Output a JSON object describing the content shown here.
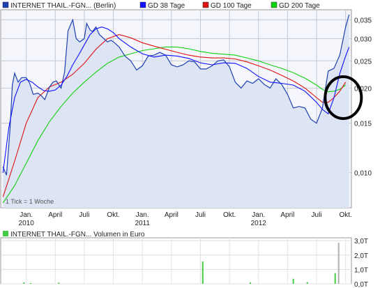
{
  "chart_data": {
    "type": "line",
    "legend": [
      {
        "label": "INTERNET THAIL.-FGN... (Berlin)",
        "color": "#1f3fb0",
        "key": "price"
      },
      {
        "label": "GD 38 Tage",
        "color": "#1010ff",
        "key": "ma38"
      },
      {
        "label": "GD 100 Tage",
        "color": "#e01010",
        "key": "ma100"
      },
      {
        "label": "GD 200 Tage",
        "color": "#10d010",
        "key": "ma200"
      }
    ],
    "x_ticks": [
      {
        "label": "Jan.",
        "year": "2010",
        "t": 0.0
      },
      {
        "label": "April",
        "t": 0.25
      },
      {
        "label": "Juli",
        "t": 0.5
      },
      {
        "label": "Okt.",
        "t": 0.75
      },
      {
        "label": "Jan.",
        "year": "2011",
        "t": 1.0
      },
      {
        "label": "April",
        "t": 1.25
      },
      {
        "label": "Juli",
        "t": 1.5
      },
      {
        "label": "Okt.",
        "t": 1.75
      },
      {
        "label": "Jan.",
        "year": "2012",
        "t": 2.0
      },
      {
        "label": "April",
        "t": 2.25
      },
      {
        "label": "Juli",
        "t": 2.5
      },
      {
        "label": "Okt.",
        "t": 2.75
      }
    ],
    "y_ticks": [
      "0,035",
      "0,030",
      "0,025",
      "0,020",
      "0,015",
      "0,010"
    ],
    "y_tick_values": [
      0.035,
      0.03,
      0.025,
      0.02,
      0.015,
      0.01
    ],
    "y_scale": "log",
    "ylim": [
      0.0075,
      0.038
    ],
    "xlim": [
      -0.22,
      2.8
    ],
    "note": "1 Tick = 1 Woche",
    "series": [
      {
        "key": "price",
        "x": [
          -0.2,
          -0.17,
          -0.14,
          -0.12,
          -0.1,
          -0.07,
          -0.04,
          0.0,
          0.03,
          0.06,
          0.1,
          0.13,
          0.16,
          0.2,
          0.23,
          0.26,
          0.3,
          0.33,
          0.36,
          0.4,
          0.43,
          0.46,
          0.5,
          0.52,
          0.55,
          0.57,
          0.6,
          0.63,
          0.66,
          0.7,
          0.73,
          0.76,
          0.8,
          0.85,
          0.9,
          0.95,
          1.0,
          1.05,
          1.1,
          1.15,
          1.2,
          1.25,
          1.3,
          1.35,
          1.4,
          1.45,
          1.5,
          1.55,
          1.6,
          1.65,
          1.7,
          1.75,
          1.8,
          1.85,
          1.9,
          1.95,
          2.0,
          2.05,
          2.1,
          2.15,
          2.2,
          2.25,
          2.3,
          2.35,
          2.4,
          2.45,
          2.5,
          2.55,
          2.6,
          2.65,
          2.7,
          2.73,
          2.75,
          2.78
        ],
        "values": [
          0.0105,
          0.0098,
          0.0142,
          0.0205,
          0.0226,
          0.021,
          0.0218,
          0.0218,
          0.0208,
          0.019,
          0.0192,
          0.0188,
          0.0182,
          0.0202,
          0.021,
          0.0212,
          0.02,
          0.0228,
          0.032,
          0.035,
          0.03,
          0.0292,
          0.03,
          0.034,
          0.0322,
          0.0318,
          0.033,
          0.031,
          0.0302,
          0.0292,
          0.0296,
          0.029,
          0.028,
          0.026,
          0.025,
          0.0232,
          0.024,
          0.026,
          0.0262,
          0.0268,
          0.0262,
          0.0242,
          0.0238,
          0.0242,
          0.025,
          0.0248,
          0.0234,
          0.0234,
          0.024,
          0.025,
          0.0252,
          0.0238,
          0.021,
          0.02,
          0.0212,
          0.0208,
          0.0216,
          0.0206,
          0.02,
          0.0216,
          0.0206,
          0.019,
          0.017,
          0.0172,
          0.017,
          0.0155,
          0.015,
          0.017,
          0.023,
          0.0235,
          0.0262,
          0.03,
          0.033,
          0.0365
        ]
      },
      {
        "key": "ma38",
        "x": [
          -0.2,
          -0.15,
          -0.1,
          -0.05,
          0.0,
          0.05,
          0.1,
          0.15,
          0.2,
          0.25,
          0.3,
          0.35,
          0.4,
          0.45,
          0.5,
          0.55,
          0.6,
          0.65,
          0.7,
          0.75,
          0.8,
          0.9,
          1.0,
          1.1,
          1.2,
          1.3,
          1.4,
          1.5,
          1.6,
          1.7,
          1.8,
          1.9,
          2.0,
          2.1,
          2.2,
          2.3,
          2.4,
          2.5,
          2.55,
          2.6,
          2.65,
          2.7,
          2.75,
          2.78
        ],
        "values": [
          0.01,
          0.0145,
          0.0185,
          0.021,
          0.0215,
          0.021,
          0.0202,
          0.0196,
          0.0195,
          0.0197,
          0.0205,
          0.022,
          0.0242,
          0.0262,
          0.0285,
          0.031,
          0.0325,
          0.033,
          0.0325,
          0.0315,
          0.03,
          0.028,
          0.0265,
          0.0258,
          0.0262,
          0.026,
          0.0255,
          0.0246,
          0.0242,
          0.0246,
          0.0245,
          0.0235,
          0.022,
          0.021,
          0.0208,
          0.0205,
          0.0195,
          0.0178,
          0.0168,
          0.0162,
          0.0185,
          0.0225,
          0.026,
          0.028
        ]
      },
      {
        "key": "ma100",
        "x": [
          -0.2,
          -0.1,
          0.0,
          0.1,
          0.2,
          0.3,
          0.4,
          0.5,
          0.6,
          0.7,
          0.8,
          0.9,
          1.0,
          1.1,
          1.2,
          1.3,
          1.4,
          1.5,
          1.6,
          1.7,
          1.8,
          1.9,
          2.0,
          2.1,
          2.2,
          2.3,
          2.4,
          2.5,
          2.55,
          2.6,
          2.65,
          2.7,
          2.75
        ],
        "values": [
          0.0082,
          0.011,
          0.015,
          0.0185,
          0.0202,
          0.021,
          0.0224,
          0.0245,
          0.0275,
          0.03,
          0.031,
          0.0302,
          0.029,
          0.0282,
          0.0275,
          0.0268,
          0.0262,
          0.0258,
          0.0256,
          0.0256,
          0.0254,
          0.0248,
          0.024,
          0.0232,
          0.0222,
          0.0212,
          0.02,
          0.0185,
          0.0178,
          0.0178,
          0.0185,
          0.0195,
          0.021
        ]
      },
      {
        "key": "ma200",
        "x": [
          -0.2,
          -0.1,
          0.0,
          0.1,
          0.2,
          0.3,
          0.4,
          0.5,
          0.6,
          0.7,
          0.8,
          0.9,
          1.0,
          1.1,
          1.2,
          1.3,
          1.4,
          1.5,
          1.6,
          1.7,
          1.8,
          1.9,
          2.0,
          2.1,
          2.2,
          2.3,
          2.4,
          2.5,
          2.55,
          2.6,
          2.65,
          2.7,
          2.75
        ],
        "values": [
          0.0078,
          0.009,
          0.0108,
          0.013,
          0.0152,
          0.0172,
          0.0192,
          0.021,
          0.0228,
          0.0245,
          0.0258,
          0.0265,
          0.0272,
          0.0276,
          0.028,
          0.028,
          0.0276,
          0.027,
          0.0266,
          0.0264,
          0.0262,
          0.0256,
          0.025,
          0.0242,
          0.0235,
          0.0227,
          0.0217,
          0.0205,
          0.0198,
          0.0194,
          0.0195,
          0.0198,
          0.0205
        ]
      }
    ],
    "volume": {
      "label": "INTERNET THAIL.-FGN... Volumen in Euro",
      "color": "#44cc44",
      "y_ticks": [
        "3,0T",
        "2,0T",
        "1,0T",
        "0,0T"
      ],
      "y_tick_values": [
        3.0,
        2.0,
        1.0,
        0.0
      ],
      "ylim": [
        0,
        3.2
      ],
      "bars": [
        {
          "t": -0.02,
          "v": 0.1
        },
        {
          "t": 0.04,
          "v": 0.05
        },
        {
          "t": 0.28,
          "v": 0.08
        },
        {
          "t": 1.52,
          "v": 1.55
        },
        {
          "t": 1.93,
          "v": 0.1
        },
        {
          "t": 2.3,
          "v": 0.35
        },
        {
          "t": 2.42,
          "v": 0.12
        },
        {
          "t": 2.66,
          "v": 0.75
        },
        {
          "t": 2.69,
          "v": 2.85
        }
      ]
    },
    "annotation": {
      "type": "circle",
      "t": 2.73,
      "value": 0.0185
    }
  }
}
